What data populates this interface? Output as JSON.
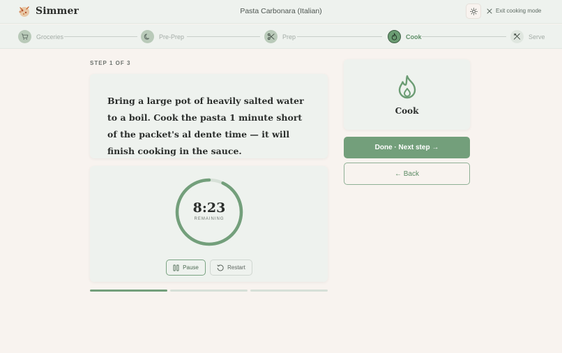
{
  "app": {
    "name": "Simmer"
  },
  "header": {
    "recipe_title": "Pasta Carbonara (Italian)",
    "exit_label": "Exit cooking mode",
    "theme_icon": "sun-icon"
  },
  "stepper": {
    "steps": [
      {
        "label": "Groceries",
        "icon": "cart-icon",
        "state": "inactive"
      },
      {
        "label": "Pre-Prep",
        "icon": "moon-icon",
        "state": "inactive"
      },
      {
        "label": "Prep",
        "icon": "scissors-icon",
        "state": "inactive"
      },
      {
        "label": "Cook",
        "icon": "flame-icon",
        "state": "active"
      },
      {
        "label": "Serve",
        "icon": "utensils-icon",
        "state": "inactive"
      }
    ]
  },
  "step": {
    "counter": "STEP 1 OF 3",
    "instruction": "Bring a large pot of heavily salted water to a boil. Cook the pasta 1 minute short of the packet's al dente time — it will finish cooking in the sauce."
  },
  "timer": {
    "value": "8:23",
    "label": "REMAINING",
    "progress_fraction": 0.93,
    "pause_label": "Pause",
    "restart_label": "Restart"
  },
  "progress": {
    "total_steps": 3,
    "completed_segments": 1
  },
  "stage": {
    "label": "Cook",
    "icon": "flame-icon"
  },
  "actions": {
    "next_label": "Done · Next step →",
    "back_label": "← Back"
  },
  "colors": {
    "accent": "#739f7b",
    "background": "#f8f3ef",
    "panel": "#eef2ee"
  }
}
